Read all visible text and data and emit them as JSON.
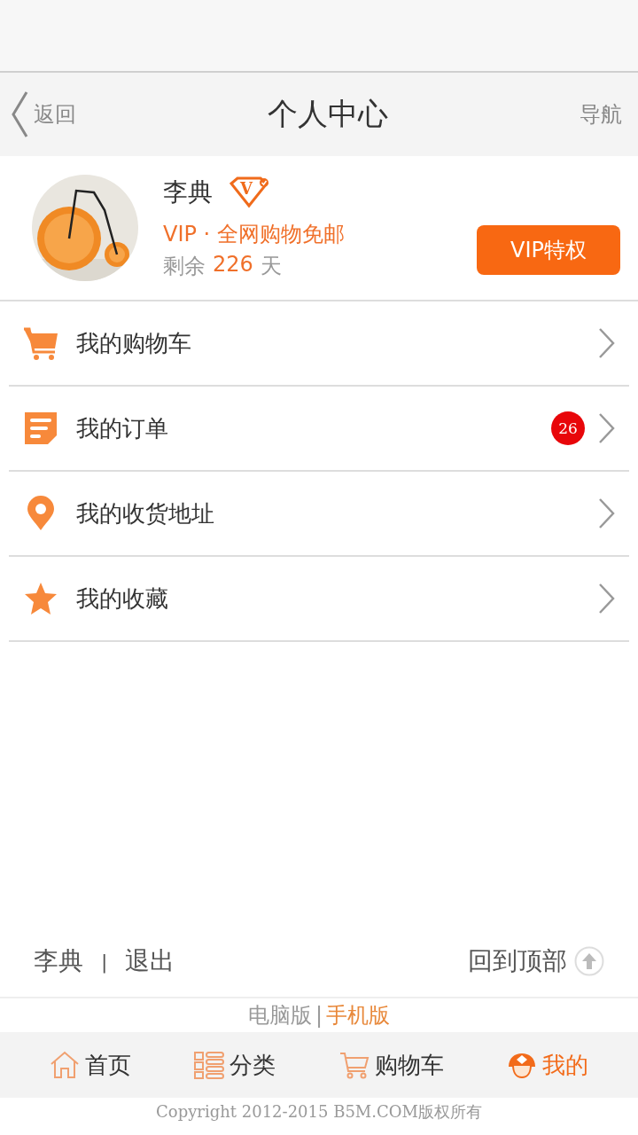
{
  "header": {
    "back": "返回",
    "title": "个人中心",
    "nav": "导航"
  },
  "profile": {
    "name": "李典",
    "vip_mark": "V",
    "vip_line": "VIP · 全网购物免邮",
    "remain_label": "剩余",
    "remain_days": "226",
    "remain_unit": "天",
    "button": "VIP特权"
  },
  "menu": [
    {
      "kind": "cart",
      "label": "我的购物车"
    },
    {
      "kind": "order",
      "label": "我的订单",
      "badge": "26"
    },
    {
      "kind": "location",
      "label": "我的收货地址"
    },
    {
      "kind": "star",
      "label": "我的收藏"
    }
  ],
  "footer": {
    "user": "李典",
    "separator": "|",
    "logout": "退出",
    "back_to_top": "回到顶部",
    "desktop": "电脑版",
    "version_separator": "|",
    "mobile": "手机版",
    "copyright": "Copyright 2012-2015 B5M.COM版权所有"
  },
  "tabs": [
    {
      "kind": "home",
      "label": "首页",
      "selected": false
    },
    {
      "kind": "category",
      "label": "分类",
      "selected": false
    },
    {
      "kind": "cart",
      "label": "购物车",
      "selected": false
    },
    {
      "kind": "me",
      "label": "我的",
      "selected": true
    }
  ]
}
